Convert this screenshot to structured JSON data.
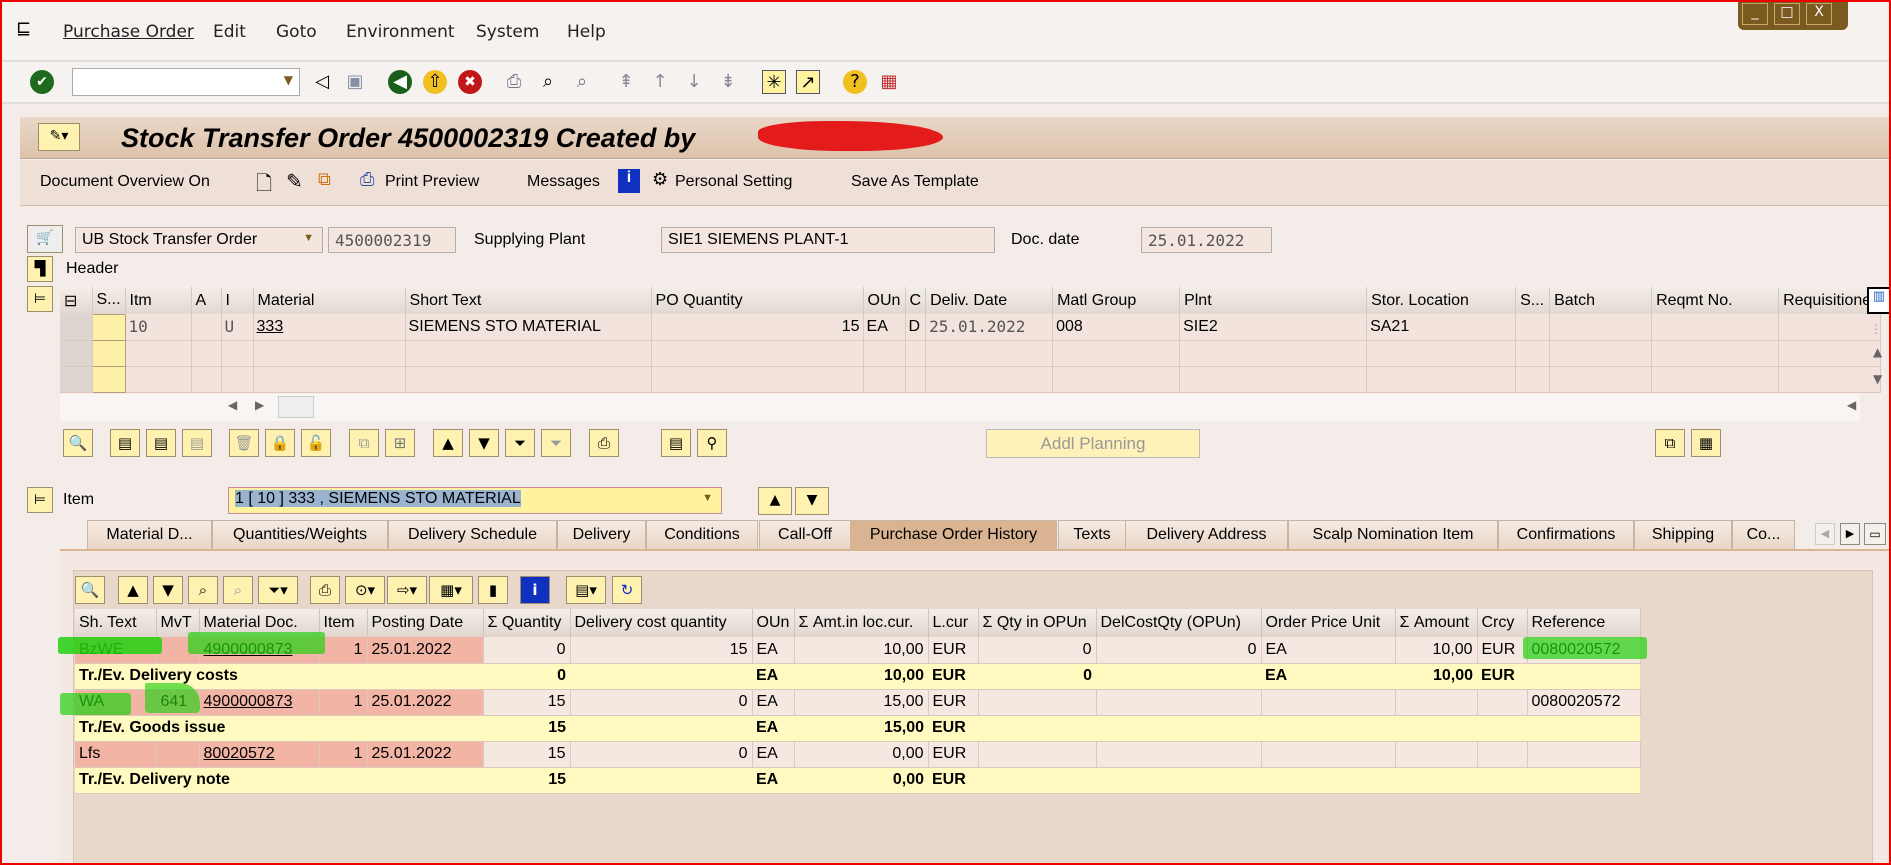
{
  "menu": [
    "Purchase Order",
    "Edit",
    "Goto",
    "Environment",
    "System",
    "Help"
  ],
  "window_controls": [
    "_",
    "□",
    "X"
  ],
  "title": "Stock Transfer Order 4500002319 Created by",
  "app_toolbar": {
    "doc_overview": "Document Overview On",
    "print_preview": "Print Preview",
    "messages": "Messages",
    "personal_setting": "Personal Setting",
    "save_template": "Save As Template"
  },
  "header": {
    "order_type": "UB Stock Transfer Order",
    "po_number": "4500002319",
    "supplying_plant_label": "Supplying Plant",
    "supplying_plant": "SIE1 SIEMENS PLANT-1",
    "doc_date_label": "Doc. date",
    "doc_date": "25.01.2022",
    "header_label": "Header"
  },
  "items_table": {
    "columns": [
      "S...",
      "Itm",
      "A",
      "I",
      "Material",
      "Short Text",
      "PO Quantity",
      "OUn",
      "C",
      "Deliv. Date",
      "Matl Group",
      "Plnt",
      "Stor. Location",
      "S...",
      "Batch",
      "Reqmt No.",
      "Requisitioner"
    ],
    "rows": [
      [
        "",
        "10",
        "",
        "U",
        "333",
        "SIEMENS STO MATERIAL",
        "15",
        "EA",
        "D",
        "25.01.2022",
        "008",
        "SIE2",
        "SA21",
        "",
        "",
        "",
        ""
      ]
    ]
  },
  "addl_planning": "Addl Planning",
  "item_selector": {
    "label": "Item",
    "value": "1 [ 10 ] 333 , SIEMENS STO MATERIAL"
  },
  "tabs": [
    "Material D...",
    "Quantities/Weights",
    "Delivery Schedule",
    "Delivery",
    "Conditions",
    "Call-Off",
    "Purchase Order History",
    "Texts",
    "Delivery Address",
    "Scalp Nomination Item",
    "Confirmations",
    "Shipping",
    "Co..."
  ],
  "active_tab": "Purchase Order History",
  "history": {
    "columns": [
      "Sh. Text",
      "MvT",
      "Material Doc.",
      "Item",
      "Posting Date",
      "Σ Quantity",
      "Delivery cost quantity",
      "OUn",
      "Σ Amt.in loc.cur.",
      "L.cur",
      "Σ Qty in OPUn",
      "DelCostQty (OPUn)",
      "Order Price Unit",
      "Σ Amount",
      "Crcy",
      "Reference"
    ],
    "rows": [
      {
        "type": "det",
        "cells": [
          "BzWE",
          "",
          "4900000873",
          "1",
          "25.01.2022",
          "0",
          "15",
          "EA",
          "10,00",
          "EUR",
          "0",
          "0",
          "EA",
          "10,00",
          "EUR",
          "0080020572"
        ]
      },
      {
        "type": "tot",
        "label": "Tr./Ev. Delivery costs",
        "quantity": "0",
        "oun": "EA",
        "amt": "10,00",
        "lcur": "EUR",
        "qty_opun": "0",
        "opu": "EA",
        "amount": "10,00",
        "crcy": "EUR"
      },
      {
        "type": "det",
        "cells": [
          "WA",
          "641",
          "4900000873",
          "1",
          "25.01.2022",
          "15",
          "0",
          "EA",
          "15,00",
          "EUR",
          "",
          "",
          "",
          "",
          "",
          "0080020572"
        ]
      },
      {
        "type": "tot",
        "label": "Tr./Ev. Goods issue",
        "quantity": "15",
        "oun": "EA",
        "amt": "15,00",
        "lcur": "EUR",
        "qty_opun": "",
        "opu": "",
        "amount": "",
        "crcy": ""
      },
      {
        "type": "det",
        "cells": [
          "Lfs",
          "",
          "80020572",
          "1",
          "25.01.2022",
          "15",
          "0",
          "EA",
          "0,00",
          "EUR",
          "",
          "",
          "",
          "",
          "",
          ""
        ]
      },
      {
        "type": "tot",
        "label": "Tr./Ev. Delivery note",
        "quantity": "15",
        "oun": "EA",
        "amt": "0,00",
        "lcur": "EUR",
        "qty_opun": "",
        "opu": "",
        "amount": "",
        "crcy": ""
      }
    ]
  }
}
